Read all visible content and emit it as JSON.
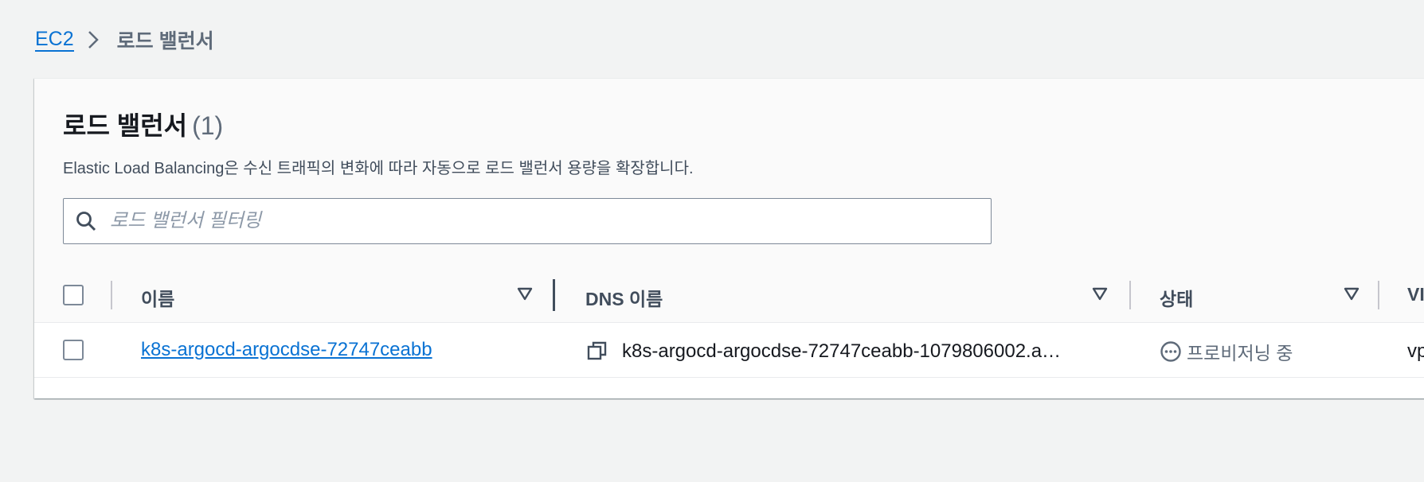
{
  "breadcrumb": {
    "root": "EC2",
    "current": "로드 밸런서"
  },
  "panel": {
    "title": "로드 밸런서",
    "count": "(1)",
    "description": "Elastic Load Balancing은 수신 트래픽의 변화에 따라 자동으로 로드 밸런서 용량을 확장합니다.",
    "search_placeholder": "로드 밸런서 필터링"
  },
  "table": {
    "columns": [
      {
        "label": "이름"
      },
      {
        "label": "DNS 이름"
      },
      {
        "label": "상태"
      },
      {
        "label": "VI"
      }
    ],
    "rows": [
      {
        "name": "k8s-argocd-argocdse-72747ceabb",
        "dns": "k8s-argocd-argocdse-72747ceabb-1079806002.a…",
        "status": "프로비저닝 중",
        "vpc": "vp"
      }
    ]
  },
  "icons": {
    "breadcrumb_separator": "chevron-right-icon",
    "search": "search-icon",
    "sort": "sort-down-icon",
    "copy": "copy-icon",
    "status": "pending-icon"
  },
  "colors": {
    "link": "#0972d3",
    "text": "#16191f",
    "muted": "#5f6b7a",
    "background": "#f2f3f3"
  }
}
